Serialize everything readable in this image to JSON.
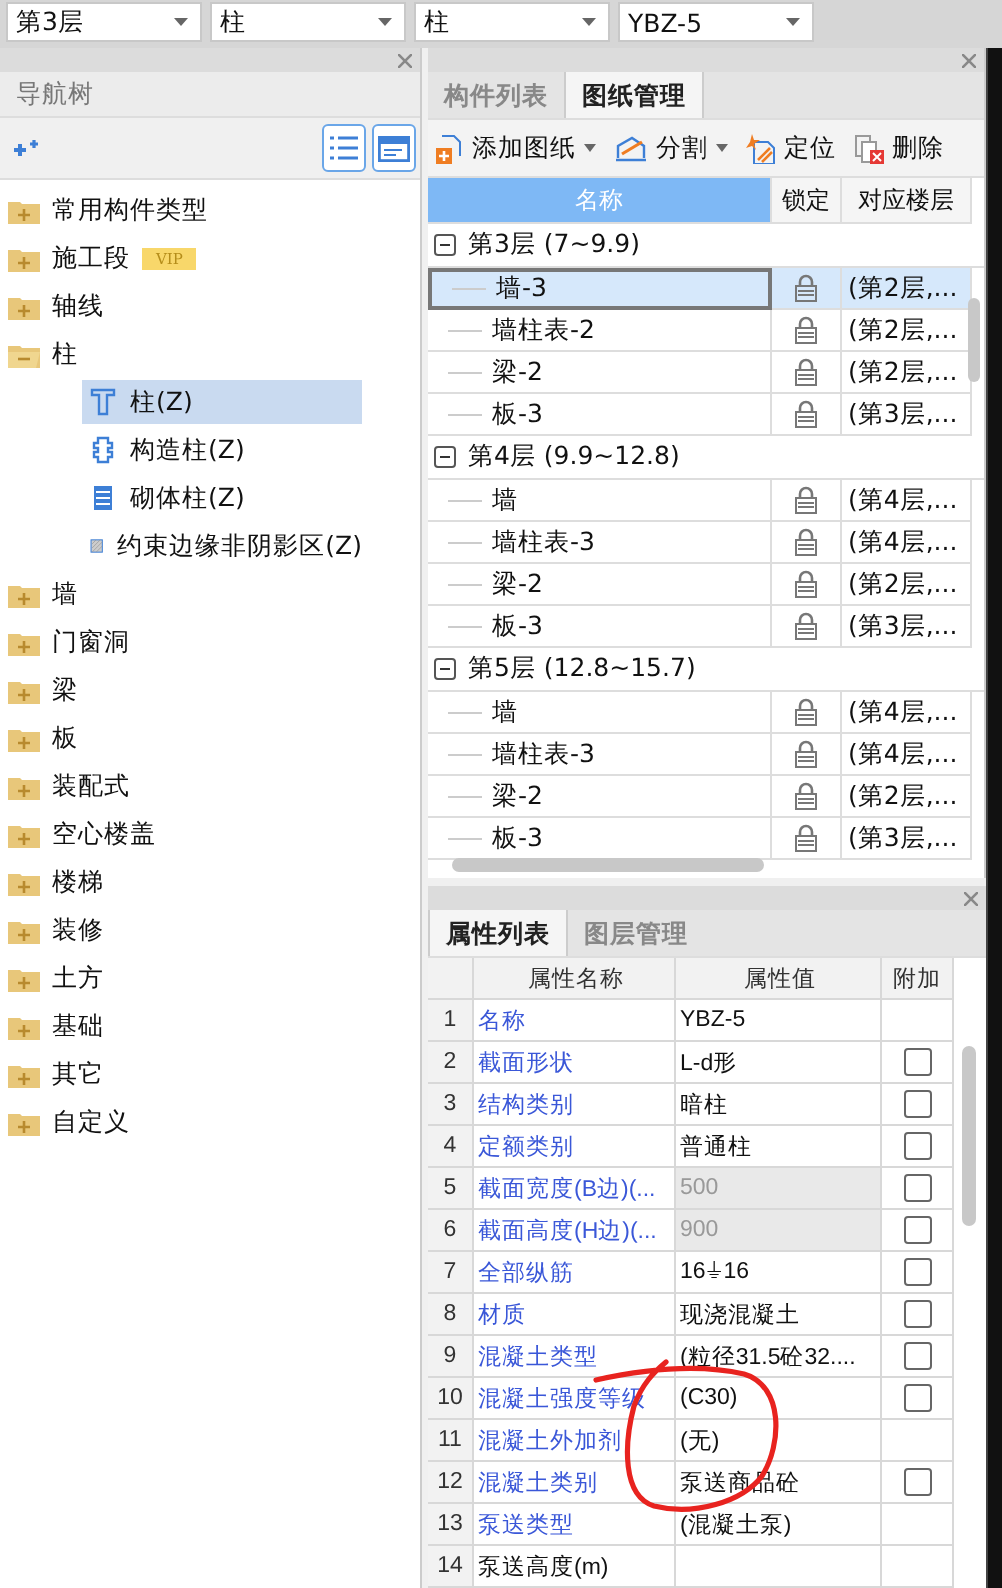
{
  "dropdowns": [
    {
      "value": "第3层"
    },
    {
      "value": "柱"
    },
    {
      "value": "柱"
    },
    {
      "value": "YBZ-5"
    }
  ],
  "nav_panel": {
    "title": "导航树",
    "view_buttons": [
      {
        "kind": "list"
      },
      {
        "kind": "window"
      }
    ],
    "tree": [
      {
        "label": "常用构件类型",
        "expanded": false
      },
      {
        "label": "施工段",
        "expanded": false,
        "badge": "VIP"
      },
      {
        "label": "轴线",
        "expanded": false
      },
      {
        "label": "柱",
        "expanded": true,
        "children": [
          {
            "label": "柱(Z)",
            "kind": "column",
            "selected": true
          },
          {
            "label": "构造柱(Z)",
            "kind": "constructional",
            "selected": false
          },
          {
            "label": "砌体柱(Z)",
            "kind": "masonry",
            "selected": false
          },
          {
            "label": "约束边缘非阴影区(Z)",
            "kind": "hatched",
            "selected": false
          }
        ]
      },
      {
        "label": "墙",
        "expanded": false
      },
      {
        "label": "门窗洞",
        "expanded": false
      },
      {
        "label": "梁",
        "expanded": false
      },
      {
        "label": "板",
        "expanded": false
      },
      {
        "label": "装配式",
        "expanded": false
      },
      {
        "label": "空心楼盖",
        "expanded": false
      },
      {
        "label": "楼梯",
        "expanded": false
      },
      {
        "label": "装修",
        "expanded": false
      },
      {
        "label": "土方",
        "expanded": false
      },
      {
        "label": "基础",
        "expanded": false
      },
      {
        "label": "其它",
        "expanded": false
      },
      {
        "label": "自定义",
        "expanded": false
      }
    ]
  },
  "drawing_panel": {
    "tabs": [
      {
        "label": "构件列表",
        "selected": false
      },
      {
        "label": "图纸管理",
        "selected": true
      }
    ],
    "toolbar": [
      {
        "label": "添加图纸",
        "kind": "add",
        "dropdown": true
      },
      {
        "label": "分割",
        "kind": "split",
        "dropdown": true
      },
      {
        "label": "定位",
        "kind": "locate",
        "dropdown": false
      },
      {
        "label": "删除",
        "kind": "delete",
        "dropdown": false
      }
    ],
    "columns": [
      {
        "label": "名称",
        "selected": true
      },
      {
        "label": "锁定",
        "selected": false
      },
      {
        "label": "对应楼层",
        "selected": false
      }
    ],
    "groups": [
      {
        "label": "第3层 (7~9.9)",
        "expanded": true,
        "rows": [
          {
            "name": "墙-3",
            "locked": true,
            "floor": "(第2层,...",
            "selected": true
          },
          {
            "name": "墙柱表-2",
            "locked": true,
            "floor": "(第2层,...",
            "selected": false
          },
          {
            "name": "梁-2",
            "locked": true,
            "floor": "(第2层,...",
            "selected": false
          },
          {
            "name": "板-3",
            "locked": true,
            "floor": "(第3层,...",
            "selected": false
          }
        ]
      },
      {
        "label": "第4层 (9.9~12.8)",
        "expanded": true,
        "rows": [
          {
            "name": "墙",
            "locked": true,
            "floor": "(第4层,...",
            "selected": false
          },
          {
            "name": "墙柱表-3",
            "locked": true,
            "floor": "(第4层,...",
            "selected": false
          },
          {
            "name": "梁-2",
            "locked": true,
            "floor": "(第2层,...",
            "selected": false
          },
          {
            "name": "板-3",
            "locked": true,
            "floor": "(第3层,...",
            "selected": false
          }
        ]
      },
      {
        "label": "第5层 (12.8~15.7)",
        "expanded": true,
        "rows": [
          {
            "name": "墙",
            "locked": true,
            "floor": "(第4层,...",
            "selected": false
          },
          {
            "name": "墙柱表-3",
            "locked": true,
            "floor": "(第4层,...",
            "selected": false
          },
          {
            "name": "梁-2",
            "locked": true,
            "floor": "(第2层,...",
            "selected": false
          },
          {
            "name": "板-3",
            "locked": true,
            "floor": "(第3层,...",
            "selected": false
          }
        ]
      }
    ]
  },
  "property_panel": {
    "tabs": [
      {
        "label": "属性列表",
        "selected": true
      },
      {
        "label": "图层管理",
        "selected": false
      }
    ],
    "columns": [
      "属性名称",
      "属性值",
      "附加"
    ],
    "rows": [
      {
        "index": "1",
        "name": "名称",
        "value": "YBZ-5",
        "linked": true,
        "disabled": false,
        "kind": "plain"
      },
      {
        "index": "2",
        "name": "截面形状",
        "value": "L-d形",
        "linked": true,
        "disabled": false,
        "kind": "checkbox",
        "checked": false
      },
      {
        "index": "3",
        "name": "结构类别",
        "value": "暗柱",
        "linked": true,
        "disabled": false,
        "kind": "checkbox",
        "checked": false
      },
      {
        "index": "4",
        "name": "定额类别",
        "value": "普通柱",
        "linked": true,
        "disabled": false,
        "kind": "checkbox",
        "checked": false
      },
      {
        "index": "5",
        "name": "截面宽度(B边)(...",
        "value": "500",
        "linked": true,
        "disabled": true,
        "kind": "checkbox",
        "checked": false
      },
      {
        "index": "6",
        "name": "截面高度(H边)(...",
        "value": "900",
        "linked": true,
        "disabled": true,
        "kind": "checkbox",
        "checked": false
      },
      {
        "index": "7",
        "name": "全部纵筋",
        "value": "16⏚16",
        "linked": true,
        "disabled": false,
        "kind": "checkbox",
        "checked": false
      },
      {
        "index": "8",
        "name": "材质",
        "value": "现浇混凝土",
        "linked": true,
        "disabled": false,
        "kind": "checkbox",
        "checked": false
      },
      {
        "index": "9",
        "name": "混凝土类型",
        "value": "(粒径31.5砼32....",
        "linked": true,
        "disabled": false,
        "kind": "checkbox",
        "checked": false
      },
      {
        "index": "10",
        "name": "混凝土强度等级",
        "value": "(C30)",
        "linked": true,
        "disabled": false,
        "kind": "checkbox",
        "checked": false
      },
      {
        "index": "11",
        "name": "混凝土外加剂",
        "value": "(无)",
        "linked": true,
        "disabled": false,
        "kind": "plain"
      },
      {
        "index": "12",
        "name": "混凝土类别",
        "value": "泵送商品砼",
        "linked": true,
        "disabled": false,
        "kind": "checkbox",
        "checked": false
      },
      {
        "index": "13",
        "name": "泵送类型",
        "value": "(混凝土泵)",
        "linked": true,
        "disabled": false,
        "kind": "plain"
      },
      {
        "index": "14",
        "name": "泵送高度(m)",
        "value": "",
        "linked": false,
        "disabled": false,
        "kind": "plain"
      }
    ]
  }
}
